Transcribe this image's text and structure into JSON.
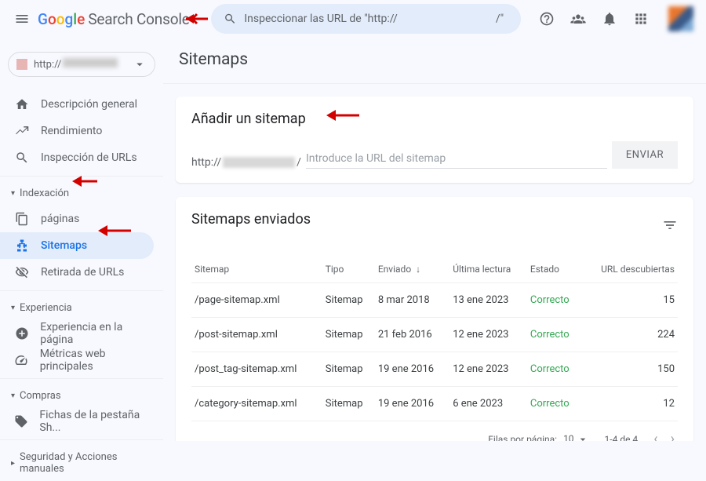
{
  "header": {
    "search_console": "Search Console",
    "search_placeholder": "Inspeccionar las URL de \"http://                                    /\""
  },
  "property": {
    "prefix": "http://"
  },
  "sidebar": {
    "overview": "Descripción general",
    "performance": "Rendimiento",
    "url_inspect": "Inspección de URLs",
    "sec_index": "Indexación",
    "pages": "páginas",
    "sitemaps": "Sitemaps",
    "removals": "Retirada de URLs",
    "sec_exp": "Experiencia",
    "page_exp": "Experiencia en la página",
    "cwv": "Métricas web principales",
    "sec_shop": "Compras",
    "shop_item": "Fichas de la pestaña Sh...",
    "sec_security": "Seguridad y Acciones manuales"
  },
  "page": {
    "title": "Sitemaps",
    "add_title": "Añadir un sitemap",
    "prefix": "http://",
    "slash": "/",
    "input_placeholder": "Introduce la URL del sitemap",
    "submit": "ENVIAR",
    "sent_title": "Sitemaps enviados"
  },
  "table": {
    "cols": {
      "sitemap": "Sitemap",
      "type": "Tipo",
      "submitted": "Enviado",
      "last_read": "Última lectura",
      "status": "Estado",
      "urls": "URL descubiertas"
    },
    "rows": [
      {
        "sitemap": "/page-sitemap.xml",
        "type": "Sitemap",
        "submitted": "8 mar 2018",
        "last_read": "13 ene 2023",
        "status": "Correcto",
        "urls": "15"
      },
      {
        "sitemap": "/post-sitemap.xml",
        "type": "Sitemap",
        "submitted": "21 feb 2016",
        "last_read": "12 ene 2023",
        "status": "Correcto",
        "urls": "224"
      },
      {
        "sitemap": "/post_tag-sitemap.xml",
        "type": "Sitemap",
        "submitted": "19 ene 2016",
        "last_read": "12 ene 2023",
        "status": "Correcto",
        "urls": "150"
      },
      {
        "sitemap": "/category-sitemap.xml",
        "type": "Sitemap",
        "submitted": "19 ene 2016",
        "last_read": "6 ene 2023",
        "status": "Correcto",
        "urls": "12"
      }
    ],
    "pager": {
      "rpp_label": "Filas por página:",
      "rpp_value": "10",
      "range": "1-4 de 4"
    }
  }
}
